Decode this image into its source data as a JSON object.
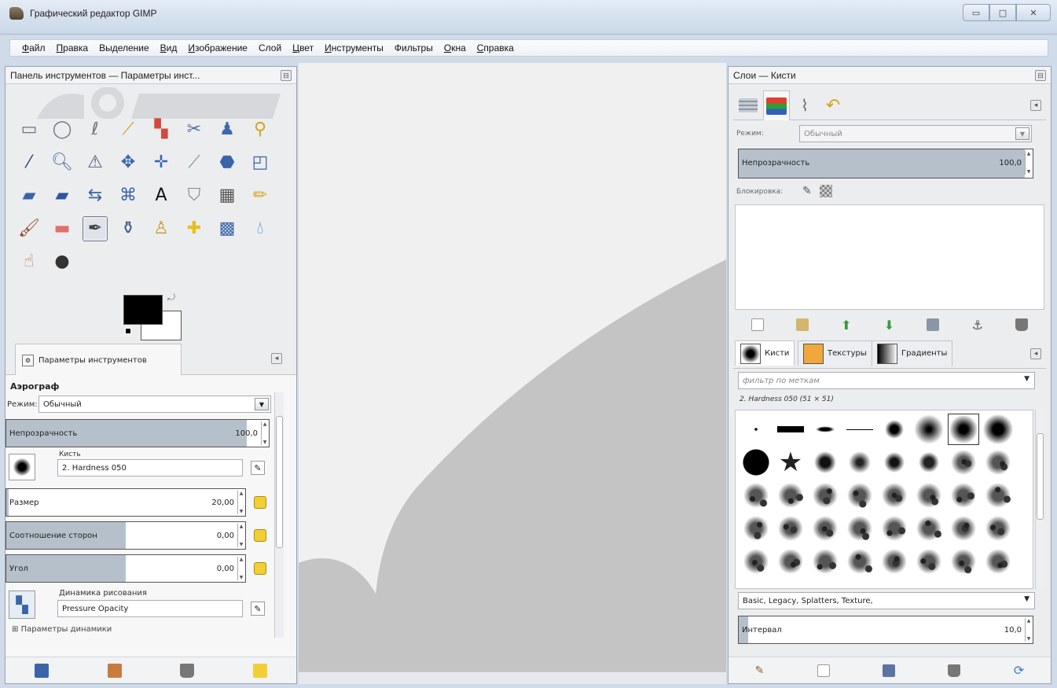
{
  "window": {
    "title": "Графический редактор GIMP",
    "buttons": [
      "▭",
      "□",
      "✕"
    ]
  },
  "menu": [
    {
      "u": "Ф",
      "rest": "айл"
    },
    {
      "u": "П",
      "rest": "равка"
    },
    {
      "u": "",
      "rest": "Выделение"
    },
    {
      "u": "В",
      "rest": "ид"
    },
    {
      "u": "И",
      "rest": "зображение"
    },
    {
      "u": "",
      "rest": "Слой"
    },
    {
      "u": "Ц",
      "rest": "вет"
    },
    {
      "u": "И",
      "rest": "нструменты"
    },
    {
      "u": "",
      "rest": "Фильтры"
    },
    {
      "u": "О",
      "rest": "кна"
    },
    {
      "u": "С",
      "rest": "правка"
    }
  ],
  "left_dock": {
    "title": "Панель инструментов — Параметры инст...",
    "tools": [
      {
        "name": "rect-select-icon",
        "glyph": "▭",
        "color": "#6b7480"
      },
      {
        "name": "ellipse-select-icon",
        "glyph": "◯",
        "color": "#6b7480"
      },
      {
        "name": "free-select-icon",
        "glyph": "ℓ",
        "color": "#6b7480"
      },
      {
        "name": "fuzzy-select-icon",
        "glyph": "⟋",
        "color": "#caa020"
      },
      {
        "name": "color-select-icon",
        "glyph": "▚",
        "color": "#d24a3c"
      },
      {
        "name": "scissors-icon",
        "glyph": "✂",
        "color": "#4b6fa6"
      },
      {
        "name": "foreground-select-icon",
        "glyph": "♟",
        "color": "#3b68b0"
      },
      {
        "name": "paths-icon",
        "glyph": "⚲",
        "color": "#d9a21c"
      },
      {
        "name": "color-picker-icon",
        "glyph": "⁄",
        "color": "#2f4d7d"
      },
      {
        "name": "zoom-icon",
        "glyph": "🔍︎",
        "color": "#4d6fa0"
      },
      {
        "name": "measure-icon",
        "glyph": "⚠",
        "color": "#4b5d7a"
      },
      {
        "name": "move-icon",
        "glyph": "✥",
        "color": "#3565b0"
      },
      {
        "name": "align-icon",
        "glyph": "✛",
        "color": "#3565b0"
      },
      {
        "name": "crop-icon",
        "glyph": "⟋",
        "color": "#7a8fa8"
      },
      {
        "name": "rotate-icon",
        "glyph": "⬣",
        "color": "#3a64a8"
      },
      {
        "name": "scale-icon",
        "glyph": "◰",
        "color": "#3a64a8"
      },
      {
        "name": "shear-icon",
        "glyph": "▰",
        "color": "#3a64a8"
      },
      {
        "name": "perspective-icon",
        "glyph": "▰",
        "color": "#2d55a0"
      },
      {
        "name": "flip-icon",
        "glyph": "⇆",
        "color": "#3a64a8"
      },
      {
        "name": "cage-icon",
        "glyph": "⌘",
        "color": "#3a64a8"
      },
      {
        "name": "text-icon",
        "glyph": "A",
        "color": "#111111"
      },
      {
        "name": "bucket-fill-icon",
        "glyph": "⛉",
        "color": "#7a8a98"
      },
      {
        "name": "blend-icon",
        "glyph": "▦",
        "color": "#555555"
      },
      {
        "name": "pencil-icon",
        "glyph": "✏",
        "color": "#d9a21c"
      },
      {
        "name": "paintbrush-icon",
        "glyph": "🖌︎",
        "color": "#8a4a22"
      },
      {
        "name": "eraser-icon",
        "glyph": "▬",
        "color": "#e0706a"
      },
      {
        "name": "airbrush-icon",
        "glyph": "✒",
        "color": "#444444"
      },
      {
        "name": "ink-icon",
        "glyph": "⚱",
        "color": "#3b5d8a"
      },
      {
        "name": "clone-icon",
        "glyph": "♙",
        "color": "#c49a2a"
      },
      {
        "name": "heal-icon",
        "glyph": "✚",
        "color": "#e6c020"
      },
      {
        "name": "perspective-clone-icon",
        "glyph": "▩",
        "color": "#3a64a8"
      },
      {
        "name": "blur-icon",
        "glyph": "💧︎",
        "color": "#4a86c8"
      },
      {
        "name": "smudge-icon",
        "glyph": "☝",
        "color": "#c07a50"
      },
      {
        "name": "dodge-burn-icon",
        "glyph": "●",
        "color": "#333333"
      }
    ],
    "tab_label": "Параметры инструментов",
    "options": {
      "tool_name": "Аэрограф",
      "mode_label": "Режим:",
      "mode_value": "Обычный",
      "opacity_label": "Непрозрачность",
      "opacity_value": "100,0",
      "opacity_fraction": 1.0,
      "brush_label": "Кисть",
      "brush_value": "2. Hardness 050",
      "size_label": "Размер",
      "size_value": "20,00",
      "aspect_label": "Соотношение сторон",
      "aspect_value": "0,00",
      "angle_label": "Угол",
      "angle_value": "0,00",
      "dynamics_label": "Динамика рисования",
      "dynamics_value": "Pressure Opacity",
      "dynamics_params": "Параметры динамики"
    }
  },
  "right_dock": {
    "title": "Слои — Кисти",
    "mode_label": "Режим:",
    "mode_value": "Обычный",
    "opacity_label": "Непрозрачность",
    "opacity_value": "100,0",
    "lock_label": "Блокировка:",
    "brush_tabs": [
      "Кисти",
      "Текстуры",
      "Градиенты"
    ],
    "filter_placeholder": "фильтр по меткам",
    "brush_selected": "2. Hardness 050 (51 × 51)",
    "tag_value": "Basic, Legacy, Splatters, Texture,",
    "spacing_label": "Интервал",
    "spacing_value": "10,0"
  },
  "colors": {
    "dock_bg": "#ecedef",
    "slider_fill": "#b6c0ca",
    "canvas_bg": "#f0f0f0",
    "canvas_shape": "#c4c4c4"
  }
}
